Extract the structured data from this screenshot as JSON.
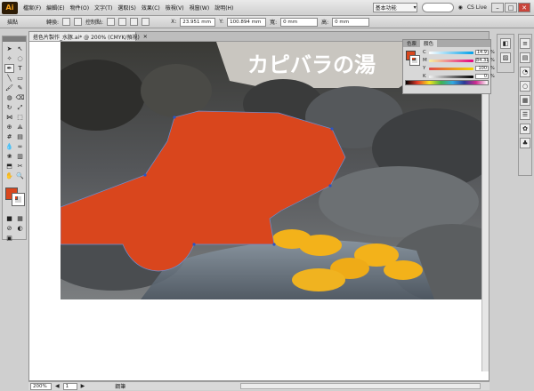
{
  "app": {
    "logo": "Ai",
    "menus": [
      "檔案(F)",
      "編輯(E)",
      "物件(O)",
      "文字(T)",
      "選取(S)",
      "效果(C)",
      "檢視(V)",
      "視窗(W)",
      "說明(H)"
    ],
    "workspace": "基本功能",
    "cs_live": "CS Live"
  },
  "controlbar": {
    "label_left": "描點",
    "label_convert": "轉換:",
    "label_anchor": "控制點:",
    "x_label": "X:",
    "x_value": "23.951 mm",
    "y_label": "Y:",
    "y_value": "100.894 mm",
    "w_label": "寬:",
    "w_value": "0 mm",
    "h_label": "高:",
    "h_value": "0 mm"
  },
  "document": {
    "tab_title": "搭色片製作_水豚.ai* @ 200% (CMYK/預視)",
    "sign_text": "カピバラの湯"
  },
  "statusbar": {
    "zoom": "200%",
    "page": "1",
    "tool_label": "鋼筆"
  },
  "color_panel": {
    "tabs": [
      "色票",
      "顏色"
    ],
    "fill_color": "#d9461d",
    "channels": [
      {
        "letter": "C",
        "value": "14.9",
        "unit": "%",
        "gradient": "linear-gradient(90deg,#ffffff,#00a0e9)"
      },
      {
        "letter": "M",
        "value": "84.31",
        "unit": "%",
        "gradient": "linear-gradient(90deg,#f7f3a0,#e4007f)"
      },
      {
        "letter": "Y",
        "value": "100",
        "unit": "%",
        "gradient": "linear-gradient(90deg,#e04a4a,#f5d500)"
      },
      {
        "letter": "K",
        "value": "0",
        "unit": "%",
        "gradient": "linear-gradient(90deg,#f4f4f4,#000000)"
      }
    ]
  },
  "colors": {
    "shape_fill": "#d9461d",
    "lemon": "#f3b21a"
  }
}
